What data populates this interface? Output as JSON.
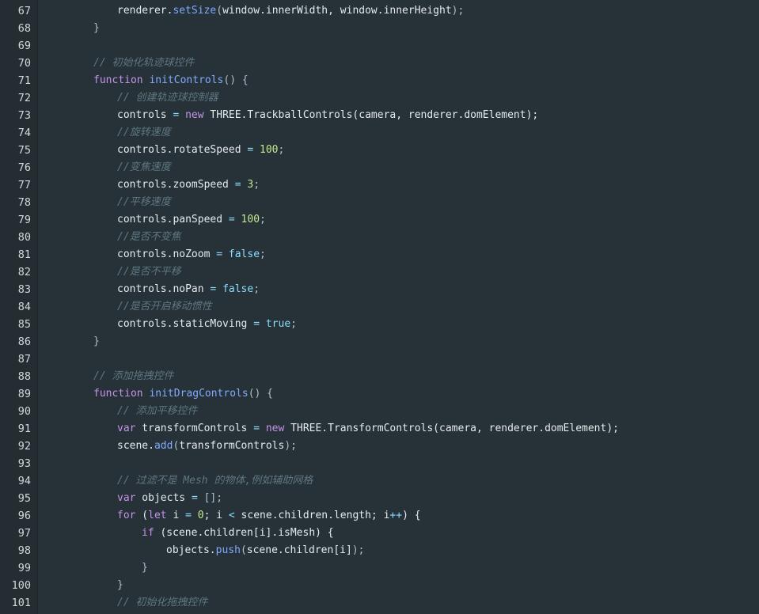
{
  "editor": {
    "lines": [
      {
        "n": "67",
        "tokens": [
          [
            "plain",
            "renderer."
          ],
          [
            "fn",
            "setSize"
          ],
          [
            "punct",
            "("
          ],
          [
            "plain",
            "window.innerWidth, window.innerHeight"
          ],
          [
            "punct",
            ");"
          ]
        ]
      },
      {
        "n": "68",
        "tokens": [
          [
            "punct",
            "}"
          ]
        ]
      },
      {
        "n": "69",
        "tokens": []
      },
      {
        "n": "70",
        "tokens": [
          [
            "comment",
            "// 初始化轨迹球控件"
          ]
        ]
      },
      {
        "n": "71",
        "tokens": [
          [
            "keyword",
            "function "
          ],
          [
            "fn",
            "initControls"
          ],
          [
            "punct",
            "() {"
          ]
        ]
      },
      {
        "n": "72",
        "tokens": [
          [
            "comment",
            "// 创建轨迹球控制器"
          ]
        ]
      },
      {
        "n": "73",
        "tokens": [
          [
            "plain",
            "controls "
          ],
          [
            "op",
            "="
          ],
          [
            "plain",
            " "
          ],
          [
            "keyword",
            "new"
          ],
          [
            "plain",
            " THREE.TrackballControls(camera, renderer.domElement);"
          ]
        ]
      },
      {
        "n": "74",
        "tokens": [
          [
            "comment",
            "//旋转速度"
          ]
        ]
      },
      {
        "n": "75",
        "tokens": [
          [
            "plain",
            "controls.rotateSpeed "
          ],
          [
            "op",
            "="
          ],
          [
            "plain",
            " "
          ],
          [
            "num",
            "100"
          ],
          [
            "punct",
            ";"
          ]
        ]
      },
      {
        "n": "76",
        "tokens": [
          [
            "comment",
            "//变焦速度"
          ]
        ]
      },
      {
        "n": "77",
        "tokens": [
          [
            "plain",
            "controls.zoomSpeed "
          ],
          [
            "op",
            "="
          ],
          [
            "plain",
            " "
          ],
          [
            "num",
            "3"
          ],
          [
            "punct",
            ";"
          ]
        ]
      },
      {
        "n": "78",
        "tokens": [
          [
            "comment",
            "//平移速度"
          ]
        ]
      },
      {
        "n": "79",
        "tokens": [
          [
            "plain",
            "controls.panSpeed "
          ],
          [
            "op",
            "="
          ],
          [
            "plain",
            " "
          ],
          [
            "num",
            "100"
          ],
          [
            "punct",
            ";"
          ]
        ]
      },
      {
        "n": "80",
        "tokens": [
          [
            "comment",
            "//是否不变焦"
          ]
        ]
      },
      {
        "n": "81",
        "tokens": [
          [
            "plain",
            "controls.noZoom "
          ],
          [
            "op",
            "="
          ],
          [
            "plain",
            " "
          ],
          [
            "bool",
            "false"
          ],
          [
            "punct",
            ";"
          ]
        ]
      },
      {
        "n": "82",
        "tokens": [
          [
            "comment",
            "//是否不平移"
          ]
        ]
      },
      {
        "n": "83",
        "tokens": [
          [
            "plain",
            "controls.noPan "
          ],
          [
            "op",
            "="
          ],
          [
            "plain",
            " "
          ],
          [
            "bool",
            "false"
          ],
          [
            "punct",
            ";"
          ]
        ]
      },
      {
        "n": "84",
        "tokens": [
          [
            "comment",
            "//是否开启移动惯性"
          ]
        ]
      },
      {
        "n": "85",
        "tokens": [
          [
            "plain",
            "controls.staticMoving "
          ],
          [
            "op",
            "="
          ],
          [
            "plain",
            " "
          ],
          [
            "bool",
            "true"
          ],
          [
            "punct",
            ";"
          ]
        ]
      },
      {
        "n": "86",
        "tokens": [
          [
            "punct",
            "}"
          ]
        ]
      },
      {
        "n": "87",
        "tokens": []
      },
      {
        "n": "88",
        "tokens": [
          [
            "comment",
            "// 添加拖拽控件"
          ]
        ]
      },
      {
        "n": "89",
        "tokens": [
          [
            "keyword",
            "function "
          ],
          [
            "fn",
            "initDragControls"
          ],
          [
            "punct",
            "() {"
          ]
        ]
      },
      {
        "n": "90",
        "tokens": [
          [
            "comment",
            "// 添加平移控件"
          ]
        ]
      },
      {
        "n": "91",
        "tokens": [
          [
            "keyword",
            "var"
          ],
          [
            "plain",
            " transformControls "
          ],
          [
            "op",
            "="
          ],
          [
            "plain",
            " "
          ],
          [
            "keyword",
            "new"
          ],
          [
            "plain",
            " THREE.TransformControls(camera, renderer.domElement);"
          ]
        ]
      },
      {
        "n": "92",
        "tokens": [
          [
            "plain",
            "scene."
          ],
          [
            "fn",
            "add"
          ],
          [
            "punct",
            "("
          ],
          [
            "plain",
            "transformControls"
          ],
          [
            "punct",
            ");"
          ]
        ]
      },
      {
        "n": "93",
        "tokens": []
      },
      {
        "n": "94",
        "tokens": [
          [
            "comment",
            "// 过滤不是 Mesh 的物体,例如辅助网格"
          ]
        ]
      },
      {
        "n": "95",
        "tokens": [
          [
            "keyword",
            "var"
          ],
          [
            "plain",
            " objects "
          ],
          [
            "op",
            "="
          ],
          [
            "plain",
            " "
          ],
          [
            "punct",
            "[];"
          ]
        ]
      },
      {
        "n": "96",
        "tokens": [
          [
            "keyword",
            "for"
          ],
          [
            "plain",
            " ("
          ],
          [
            "keyword",
            "let"
          ],
          [
            "plain",
            " i "
          ],
          [
            "op",
            "="
          ],
          [
            "plain",
            " "
          ],
          [
            "num",
            "0"
          ],
          [
            "plain",
            "; i "
          ],
          [
            "op",
            "<"
          ],
          [
            "plain",
            " scene.children.length; i"
          ],
          [
            "op",
            "++"
          ],
          [
            "plain",
            ") {"
          ]
        ]
      },
      {
        "n": "97",
        "tokens": [
          [
            "keyword",
            "if"
          ],
          [
            "plain",
            " (scene.children[i].isMesh) {"
          ]
        ]
      },
      {
        "n": "98",
        "tokens": [
          [
            "plain",
            "objects."
          ],
          [
            "fn",
            "push"
          ],
          [
            "punct",
            "("
          ],
          [
            "plain",
            "scene.children[i]"
          ],
          [
            "punct",
            ");"
          ]
        ]
      },
      {
        "n": "99",
        "tokens": [
          [
            "punct",
            "}"
          ]
        ]
      },
      {
        "n": "100",
        "tokens": [
          [
            "punct",
            "}"
          ]
        ]
      },
      {
        "n": "101",
        "tokens": [
          [
            "comment",
            "// 初始化拖拽控件"
          ]
        ]
      }
    ]
  }
}
